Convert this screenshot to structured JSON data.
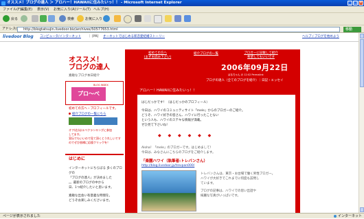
{
  "window": {
    "title": "オススメ！ブログの達人 ＞ アロハー！HAWAIIに住みたいっ！！ - Microsoft Internet Explorer",
    "min": "_",
    "max": "□",
    "close": "×"
  },
  "menu": [
    "ファイル(F)",
    "編集(E)",
    "表示(V)",
    "お気に入り(A)",
    "ツール(T)",
    "ヘルプ(H)"
  ],
  "toolbar": {
    "back": "戻る",
    "search": "検索",
    "favorites": "お気に入り"
  },
  "address": {
    "label": "アドレス(D)",
    "url": "http://blogtatsujin.livedoor.biz/archives/50577653.html",
    "go": "移動",
    "links": "リンク"
  },
  "page": {
    "logo_text": "livedoor Blog",
    "crumb1": "コンピュータ/インターネット",
    "crumb_sep": "｜",
    "pr_tag": "[PR]",
    "pr_text": "オーネットではじめる新恋愛結婚ストーリー",
    "report_link": "ヘルプ / ブログを始めよう",
    "site_title": "オススメ！",
    "site_title2": "ブログの達人",
    "site_sub": "素敵なブログ本日紹介",
    "nav1": "初めての方へ",
    "nav1b": "(まずお読み下さい)",
    "nav2": "紹介ブログの一覧",
    "nav3": "ブロガーに記載して紹介",
    "nav3b": "希望してもいいです",
    "date": "2006年09月22日",
    "byline_small": "ばるちゃん の 12:02 Permalink",
    "byline": "ブログの達人（全てのブログを紹介）｜日記・エッセイ",
    "side_label": "BLOG INDEX",
    "side_logo": "プロ～べ",
    "side_lead": "初めての方へ・プロフィールです。",
    "side_link": "紹介ブログの一覧にちら",
    "side_note1": "オフ(右)はエベクランキングに参加",
    "side_note2": "してます。",
    "side_note3": "宣伝でもいいので見て頂くとうれしいです",
    "side_note4": "のでぜひ皆様に応援クリックを！",
    "side_head2": "はじめに",
    "intro1": "インターネットにちらばる 多くのブログの",
    "intro2": "「ブログの達人」が決めました",
    "intro3": "。。最新のブログの中から",
    "intro4": "日、1つ紹介したいと思います。",
    "intro5": "",
    "intro6": "素敵な出会い有意義な時間を。",
    "intro7": "どうぞお楽しみくださいませ。",
    "post_title": "アロハー！HAWAIIに住みたいっ！！",
    "p1": "はじだっかです！（はじだっかのプロフィール）",
    "p2a": "今日は、ハワイのコミュニティサイト「mele」からのブロガーのご紹介。",
    "p2b": "どうぞ、ハワイ好きの皆さん、ハワイに行ったことない",
    "p2c": "という人も、ハワイのステキな情報が満載。",
    "p2d": "ぜひ見て下さいね！",
    "stars": "◆ ◆ ◆ ◆ ◆ ◆",
    "p3": "Aloha！「mele」のブロガーです。はじめまして！",
    "p4": "今日は、みなさんにこちらのブログをご紹介します。",
    "blog_name": "「楽園ハワイ（執筆者:トレバンさん）",
    "blog_url": "http://blog.livedoor.jp/trevpan000/",
    "blog_d1": "トレバンさんは、東京・お台場で働く男性ブロガー。",
    "blog_d2": "ハワイが大好きでこれまでに何度も訪問し",
    "blog_d3": "ています。",
    "blog_d4": "ブログの記事は、ハワイでの思い出話や",
    "blog_d5": "綺麗な写真がいっぱいです。"
  },
  "status": {
    "text": "ページが表示されました",
    "zone": "インターネット"
  }
}
